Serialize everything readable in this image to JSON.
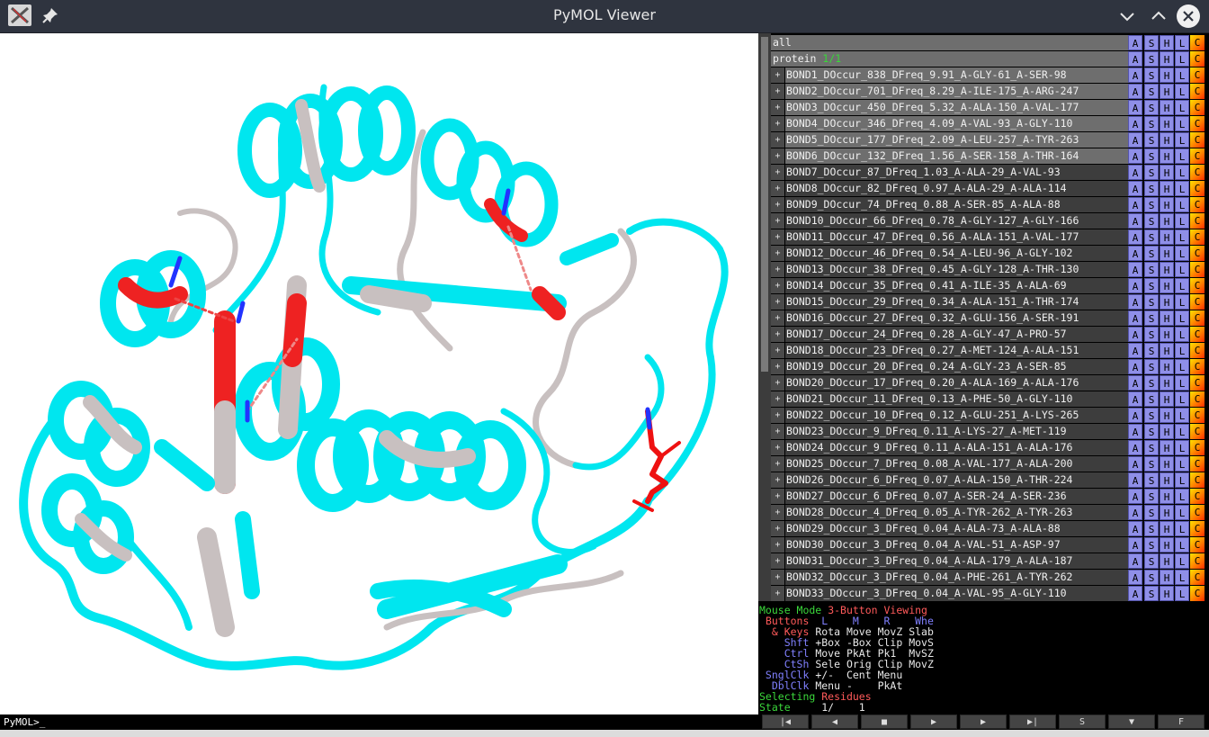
{
  "window": {
    "title": "PyMOL Viewer"
  },
  "command_line": "PyMOL>_",
  "objects": [
    {
      "name": "all",
      "state": ""
    },
    {
      "name": "protein",
      "state": "1/1"
    }
  ],
  "bond_objects": [
    "BOND1_DOccur_838_DFreq_9.91_A-GLY-61_A-SER-98",
    "BOND2_DOccur_701_DFreq_8.29_A-ILE-175_A-ARG-247",
    "BOND3_DOccur_450_DFreq_5.32_A-ALA-150_A-VAL-177",
    "BOND4_DOccur_346_DFreq_4.09_A-VAL-93_A-GLY-110",
    "BOND5_DOccur_177_DFreq_2.09_A-LEU-257_A-TYR-263",
    "BOND6_DOccur_132_DFreq_1.56_A-SER-158_A-THR-164",
    "BOND7_DOccur_87_DFreq_1.03_A-ALA-29_A-VAL-93",
    "BOND8_DOccur_82_DFreq_0.97_A-ALA-29_A-ALA-114",
    "BOND9_DOccur_74_DFreq_0.88_A-SER-85_A-ALA-88",
    "BOND10_DOccur_66_DFreq_0.78_A-GLY-127_A-GLY-166",
    "BOND11_DOccur_47_DFreq_0.56_A-ALA-151_A-VAL-177",
    "BOND12_DOccur_46_DFreq_0.54_A-LEU-96_A-GLY-102",
    "BOND13_DOccur_38_DFreq_0.45_A-GLY-128_A-THR-130",
    "BOND14_DOccur_35_DFreq_0.41_A-ILE-35_A-ALA-69",
    "BOND15_DOccur_29_DFreq_0.34_A-ALA-151_A-THR-174",
    "BOND16_DOccur_27_DFreq_0.32_A-GLU-156_A-SER-191",
    "BOND17_DOccur_24_DFreq_0.28_A-GLY-47_A-PRO-57",
    "BOND18_DOccur_23_DFreq_0.27_A-MET-124_A-ALA-151",
    "BOND19_DOccur_20_DFreq_0.24_A-GLY-23_A-SER-85",
    "BOND20_DOccur_17_DFreq_0.20_A-ALA-169_A-ALA-176",
    "BOND21_DOccur_11_DFreq_0.13_A-PHE-50_A-GLY-110",
    "BOND22_DOccur_10_DFreq_0.12_A-GLU-251_A-LYS-265",
    "BOND23_DOccur_9_DFreq_0.11_A-LYS-27_A-MET-119",
    "BOND24_DOccur_9_DFreq_0.11_A-ALA-151_A-ALA-176",
    "BOND25_DOccur_7_DFreq_0.08_A-VAL-177_A-ALA-200",
    "BOND26_DOccur_6_DFreq_0.07_A-ALA-150_A-THR-224",
    "BOND27_DOccur_6_DFreq_0.07_A-SER-24_A-SER-236",
    "BOND28_DOccur_4_DFreq_0.05_A-TYR-262_A-TYR-263",
    "BOND29_DOccur_3_DFreq_0.04_A-ALA-73_A-ALA-88",
    "BOND30_DOccur_3_DFreq_0.04_A-VAL-51_A-ASP-97",
    "BOND31_DOccur_3_DFreq_0.04_A-ALA-179_A-ALA-187",
    "BOND32_DOccur_3_DFreq_0.04_A-PHE-261_A-TYR-262",
    "BOND33_DOccur_3_DFreq_0.04_A-VAL-95_A-GLY-110"
  ],
  "bond_enabled": [
    true,
    true,
    true,
    true,
    true,
    true,
    false,
    false,
    false,
    false,
    false,
    false,
    false,
    false,
    false,
    false,
    false,
    false,
    false,
    false,
    false,
    false,
    false,
    false,
    false,
    false,
    false,
    false,
    false,
    false,
    false,
    false,
    false
  ],
  "object_buttons": [
    "A",
    "S",
    "H",
    "L",
    "C"
  ],
  "mouse_info": {
    "mode_label": "Mouse Mode",
    "mode_value": "3-Button Viewing",
    "buttons_label": "Buttons",
    "cols": [
      "L",
      "M",
      "R",
      "Wheel"
    ],
    "rows": [
      {
        "key": "& Keys",
        "vals": [
          "Rota",
          "Move",
          "MovZ",
          "Slab"
        ]
      },
      {
        "key": "Shft",
        "vals": [
          "+Box",
          "-Box",
          "Clip",
          "MovS"
        ]
      },
      {
        "key": "Ctrl",
        "vals": [
          "Move",
          "PkAt",
          "Pk1",
          "MvSZ"
        ]
      },
      {
        "key": "CtSh",
        "vals": [
          "Sele",
          "Orig",
          "Clip",
          "MovZ"
        ]
      },
      {
        "key": "SnglClk",
        "vals": [
          "+/-",
          "Cent",
          "Menu",
          ""
        ]
      },
      {
        "key": "DblClk",
        "vals": [
          "Menu",
          "-",
          "PkAt",
          ""
        ]
      }
    ],
    "selecting_label": "Selecting",
    "selecting_value": "Residues",
    "state_label": "State",
    "state_value": "1/    1"
  },
  "transport_buttons": [
    {
      "id": "rewind",
      "glyph": "|◀"
    },
    {
      "id": "back",
      "glyph": "◀"
    },
    {
      "id": "stop",
      "glyph": "■"
    },
    {
      "id": "play",
      "glyph": "▶"
    },
    {
      "id": "forward",
      "glyph": "▶"
    },
    {
      "id": "end",
      "glyph": "▶|"
    },
    {
      "id": "scene",
      "glyph": "S"
    },
    {
      "id": "down",
      "glyph": "▼"
    },
    {
      "id": "full",
      "glyph": "F"
    }
  ],
  "colors": {
    "cartoon": "#00ffff",
    "highlight": "#ee2222",
    "neutral": "#c8c0c0",
    "nitrogen": "#2222ff"
  },
  "icons": {
    "app": "pymol-app-icon",
    "pin": "pin-icon",
    "minimize": "chevron-down-icon",
    "maximize": "chevron-up-icon",
    "close": "close-icon"
  }
}
